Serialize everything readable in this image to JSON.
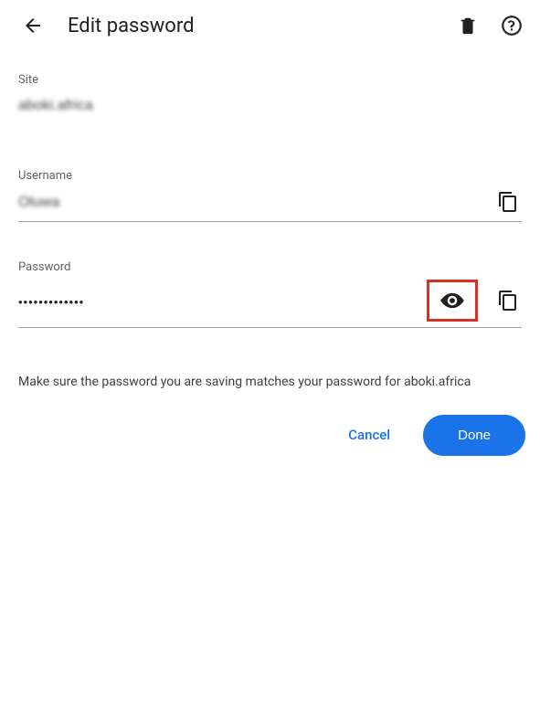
{
  "header": {
    "title": "Edit password"
  },
  "fields": {
    "site": {
      "label": "Site",
      "value": "aboki.africa"
    },
    "username": {
      "label": "Username",
      "value": "Oluwa"
    },
    "password": {
      "label": "Password",
      "value": "•••••••••••••"
    }
  },
  "hint": "Make sure the password you are saving matches your password for aboki.africa",
  "actions": {
    "cancel": "Cancel",
    "done": "Done"
  }
}
